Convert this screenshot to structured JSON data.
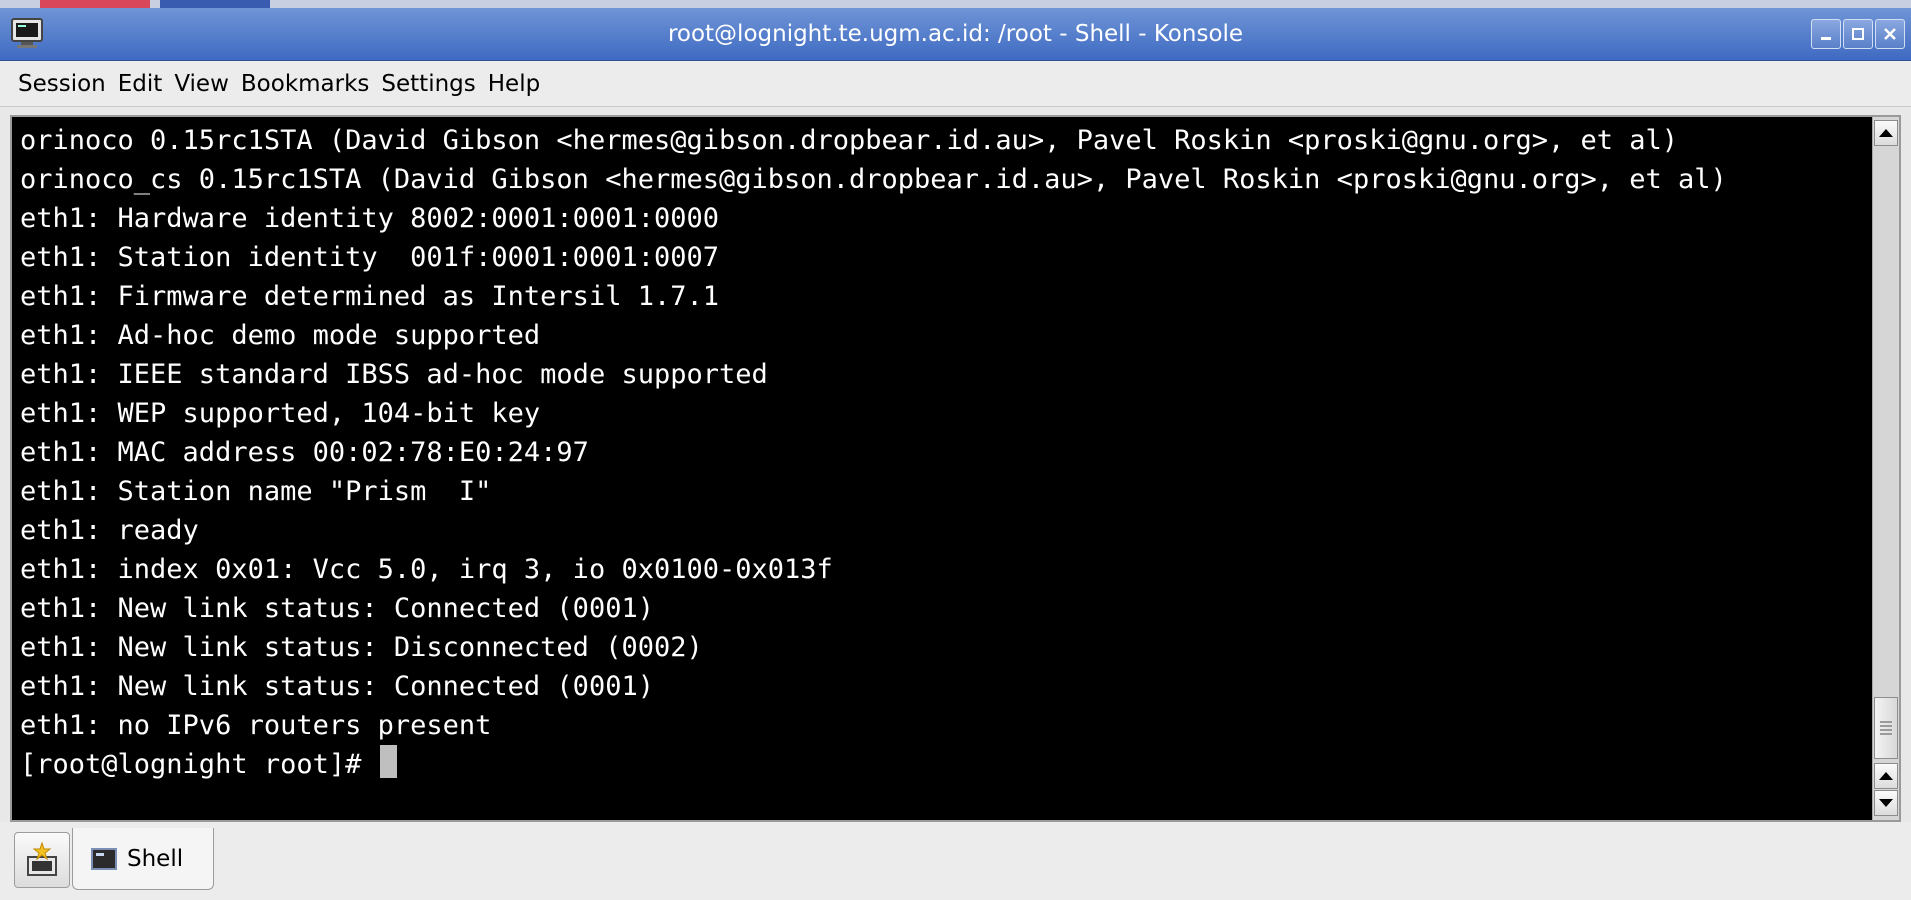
{
  "window": {
    "title": "root@lognight.te.ugm.ac.id: /root - Shell - Konsole"
  },
  "menu": {
    "items": [
      "Session",
      "Edit",
      "View",
      "Bookmarks",
      "Settings",
      "Help"
    ]
  },
  "terminal": {
    "lines": [
      "orinoco 0.15rc1STA (David Gibson <hermes@gibson.dropbear.id.au>, Pavel Roskin <proski@gnu.org>, et al)",
      "orinoco_cs 0.15rc1STA (David Gibson <hermes@gibson.dropbear.id.au>, Pavel Roskin <proski@gnu.org>, et al)",
      "eth1: Hardware identity 8002:0001:0001:0000",
      "eth1: Station identity  001f:0001:0001:0007",
      "eth1: Firmware determined as Intersil 1.7.1",
      "eth1: Ad-hoc demo mode supported",
      "eth1: IEEE standard IBSS ad-hoc mode supported",
      "eth1: WEP supported, 104-bit key",
      "eth1: MAC address 00:02:78:E0:24:97",
      "eth1: Station name \"Prism  I\"",
      "eth1: ready",
      "eth1: index 0x01: Vcc 5.0, irq 3, io 0x0100-0x013f",
      "eth1: New link status: Connected (0001)",
      "eth1: New link status: Disconnected (0002)",
      "eth1: New link status: Connected (0001)",
      "eth1: no IPv6 routers present"
    ],
    "prompt": "[root@lognight root]# "
  },
  "tabs": {
    "items": [
      {
        "label": "Shell",
        "icon": "terminal-icon"
      }
    ],
    "new_tab_icon": "new-session-icon"
  },
  "icons": {
    "window": "konsole-icon",
    "minimize": "minimize-icon",
    "maximize": "maximize-icon",
    "close": "close-icon"
  },
  "colors": {
    "titlebar": "#4f78c8",
    "terminal_bg": "#000000",
    "terminal_fg": "#ffffff",
    "chrome": "#ececec"
  }
}
